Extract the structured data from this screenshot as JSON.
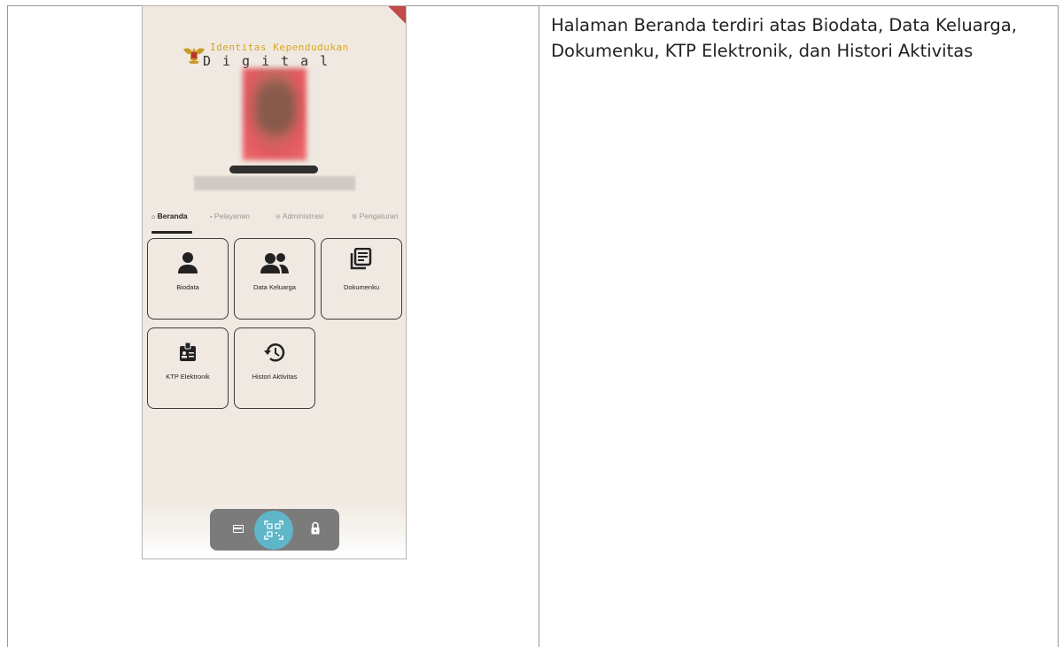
{
  "description": "Halaman Beranda terdiri atas Biodata, Data Keluarga, Dokumenku, KTP Elektronik, dan Histori Aktivitas",
  "app": {
    "title_line1": "Identitas Kependudukan",
    "title_line2": "Digital"
  },
  "tabs": [
    {
      "label": "Beranda",
      "icon": "home-icon",
      "active": true
    },
    {
      "label": "Pelayanan",
      "icon": "document-icon",
      "active": false
    },
    {
      "label": "Administrasi",
      "icon": "user-circle-icon",
      "active": false
    },
    {
      "label": "Pengaturan",
      "icon": "gear-icon",
      "active": false
    }
  ],
  "menu": [
    {
      "label": "Biodata",
      "icon": "person-icon"
    },
    {
      "label": "Data Keluarga",
      "icon": "people-icon"
    },
    {
      "label": "Dokumenku",
      "icon": "library-books-icon"
    },
    {
      "label": "KTP Elektronik",
      "icon": "badge-icon"
    },
    {
      "label": "Histori Aktivitas",
      "icon": "history-icon"
    }
  ],
  "bottom_nav": [
    {
      "icon": "card-icon"
    },
    {
      "icon": "qr-scan-icon"
    },
    {
      "icon": "lock-icon"
    }
  ],
  "colors": {
    "screen_bg": "#efe9e1",
    "title_accent": "#d9a520",
    "qr_button": "#5fb6c9",
    "bottom_nav_bg": "#7b7b7b"
  }
}
